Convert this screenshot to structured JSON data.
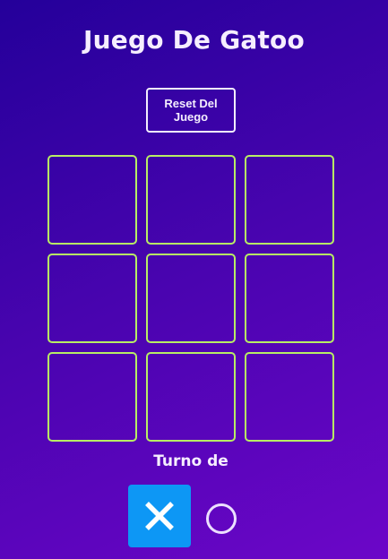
{
  "title": "Juego De Gatoo",
  "reset_button": {
    "label": "Reset Del Juego"
  },
  "board": {
    "cells": [
      "",
      "",
      "",
      "",
      "",
      "",
      "",
      "",
      ""
    ]
  },
  "turn": {
    "label": "Turno de",
    "players": [
      {
        "symbol": "X",
        "icon": "x-mark-icon",
        "active": true
      },
      {
        "symbol": "O",
        "icon": "circle-icon",
        "active": false
      }
    ]
  },
  "colors": {
    "background_start": "#24009a",
    "background_end": "#6c06c8",
    "cell_border": "#b8ee64",
    "active_player_bg": "#0d97f5",
    "text": "#f6eeff"
  }
}
